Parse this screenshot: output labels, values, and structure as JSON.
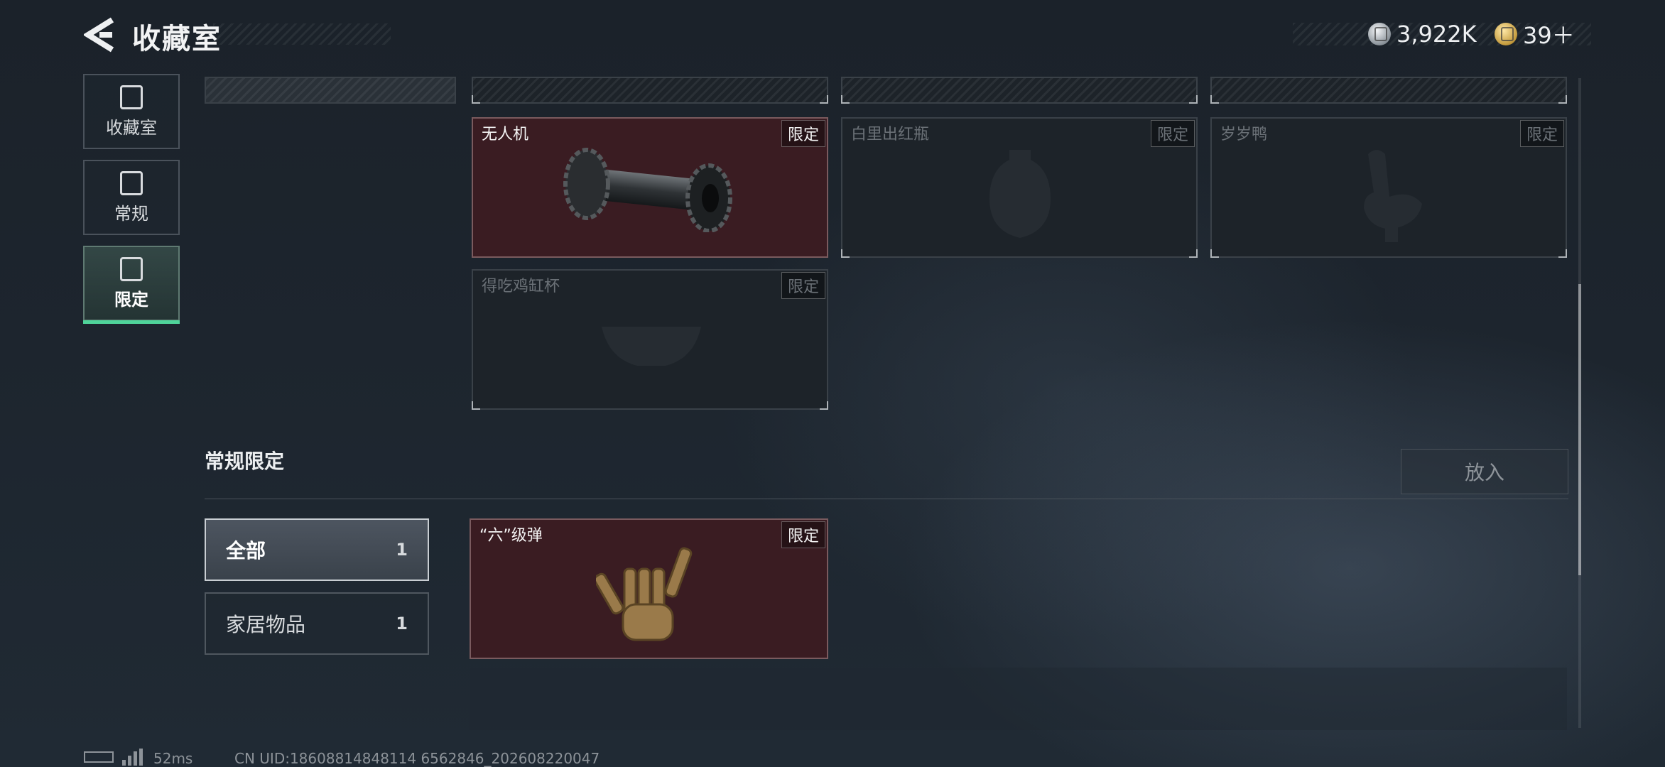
{
  "header": {
    "title": "收藏室",
    "currency": [
      {
        "icon": "silver-coin-icon",
        "value": "3,922K"
      },
      {
        "icon": "gold-coin-icon",
        "value": "39＋"
      }
    ]
  },
  "sidebar": {
    "items": [
      {
        "label": "收藏室",
        "icon": "cabinet-icon",
        "active": false
      },
      {
        "label": "常规",
        "icon": "document-icon",
        "active": false
      },
      {
        "label": "限定",
        "icon": "picture-frame-icon",
        "active": true
      }
    ]
  },
  "top_cards": [
    {
      "name": "无人机",
      "tag": "限定",
      "owned": true
    },
    {
      "name": "白里出红瓶",
      "tag": "限定",
      "owned": false
    },
    {
      "name": "岁岁鸭",
      "tag": "限定",
      "owned": false
    },
    {
      "name": "得吃鸡缸杯",
      "tag": "限定",
      "owned": false
    }
  ],
  "section": {
    "title": "常规限定",
    "put_button": "放入",
    "filters": [
      {
        "label": "全部",
        "count": "1",
        "active": true
      },
      {
        "label": "家居物品",
        "count": "1",
        "active": false
      }
    ],
    "cards": [
      {
        "name": "“六”级弹",
        "tag": "限定",
        "owned": true
      }
    ]
  },
  "footer": {
    "ping": "52ms",
    "uid": "CN UID:18608814848114 6562846_202608220047"
  }
}
